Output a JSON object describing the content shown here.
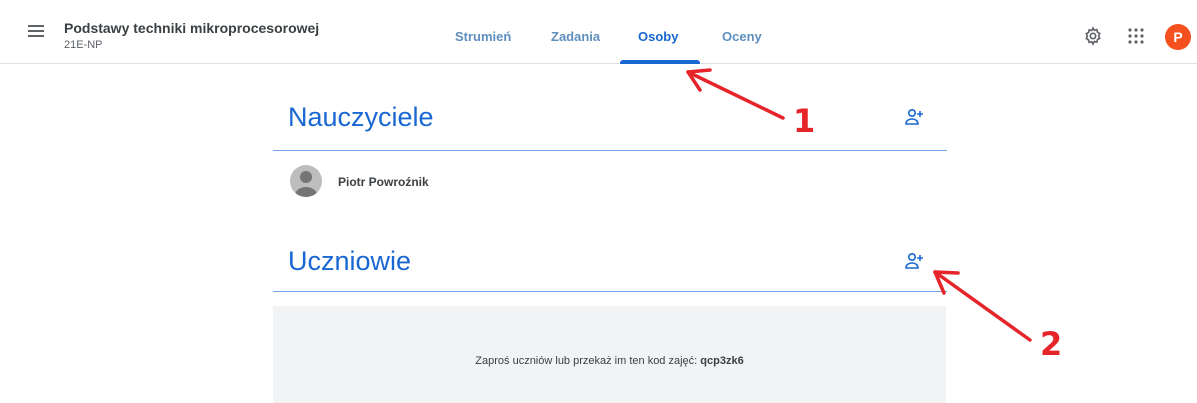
{
  "course": {
    "title": "Podstawy techniki mikroprocesorowej",
    "section": "21E-NP"
  },
  "tabs": [
    {
      "label": "Strumień",
      "active": false
    },
    {
      "label": "Zadania",
      "active": false
    },
    {
      "label": "Osoby",
      "active": true
    },
    {
      "label": "Oceny",
      "active": false
    }
  ],
  "account": {
    "initial": "P",
    "color": "#f4511e"
  },
  "teachers": {
    "title": "Nauczyciele",
    "people": [
      {
        "name": "Piotr Powroźnik"
      }
    ]
  },
  "students": {
    "title": "Uczniowie",
    "invite_text": "Zaproś uczniów lub przekaż im ten kod zajęć:",
    "class_code": "qcp3zk6"
  },
  "annotations": [
    {
      "label": "1",
      "color": "#e5252a"
    },
    {
      "label": "2",
      "color": "#e5252a"
    }
  ],
  "colors": {
    "accent": "#1967d2",
    "annotation": "#e5252a"
  },
  "icons": [
    "menu-icon",
    "gear-icon",
    "apps-grid-icon",
    "add-person-icon",
    "person-avatar-icon"
  ]
}
